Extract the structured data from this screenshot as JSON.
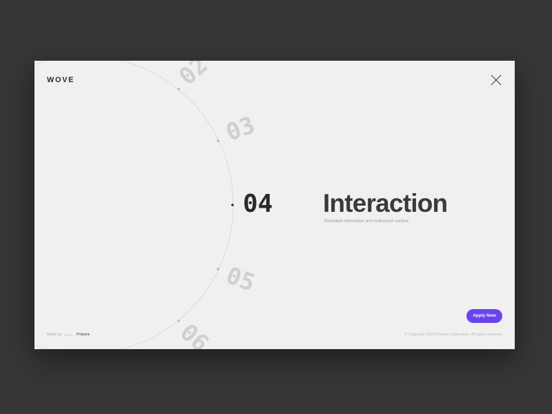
{
  "header": {
    "logo": "WOVE",
    "close_icon": "close-icon"
  },
  "wheel": {
    "items": [
      {
        "number": "02",
        "active": false
      },
      {
        "number": "03",
        "active": false
      },
      {
        "number": "04",
        "active": true
      },
      {
        "number": "05",
        "active": false
      },
      {
        "number": "06",
        "active": false
      }
    ]
  },
  "main": {
    "title": "Interaction",
    "subtitle": "Persistent information and multi-touch surface",
    "cta_label": "Apply Now"
  },
  "footer": {
    "made_by_label": "Made by",
    "made_by_name": "Polyera",
    "copyright": "© Copyright 2015 Polyera Corporation. All rights reserved."
  },
  "colors": {
    "background": "#363636",
    "panel": "#f0f0f0",
    "accent": "#6a43ee",
    "active_text": "#2a2a2a",
    "inactive_text": "#d0d0d0"
  }
}
